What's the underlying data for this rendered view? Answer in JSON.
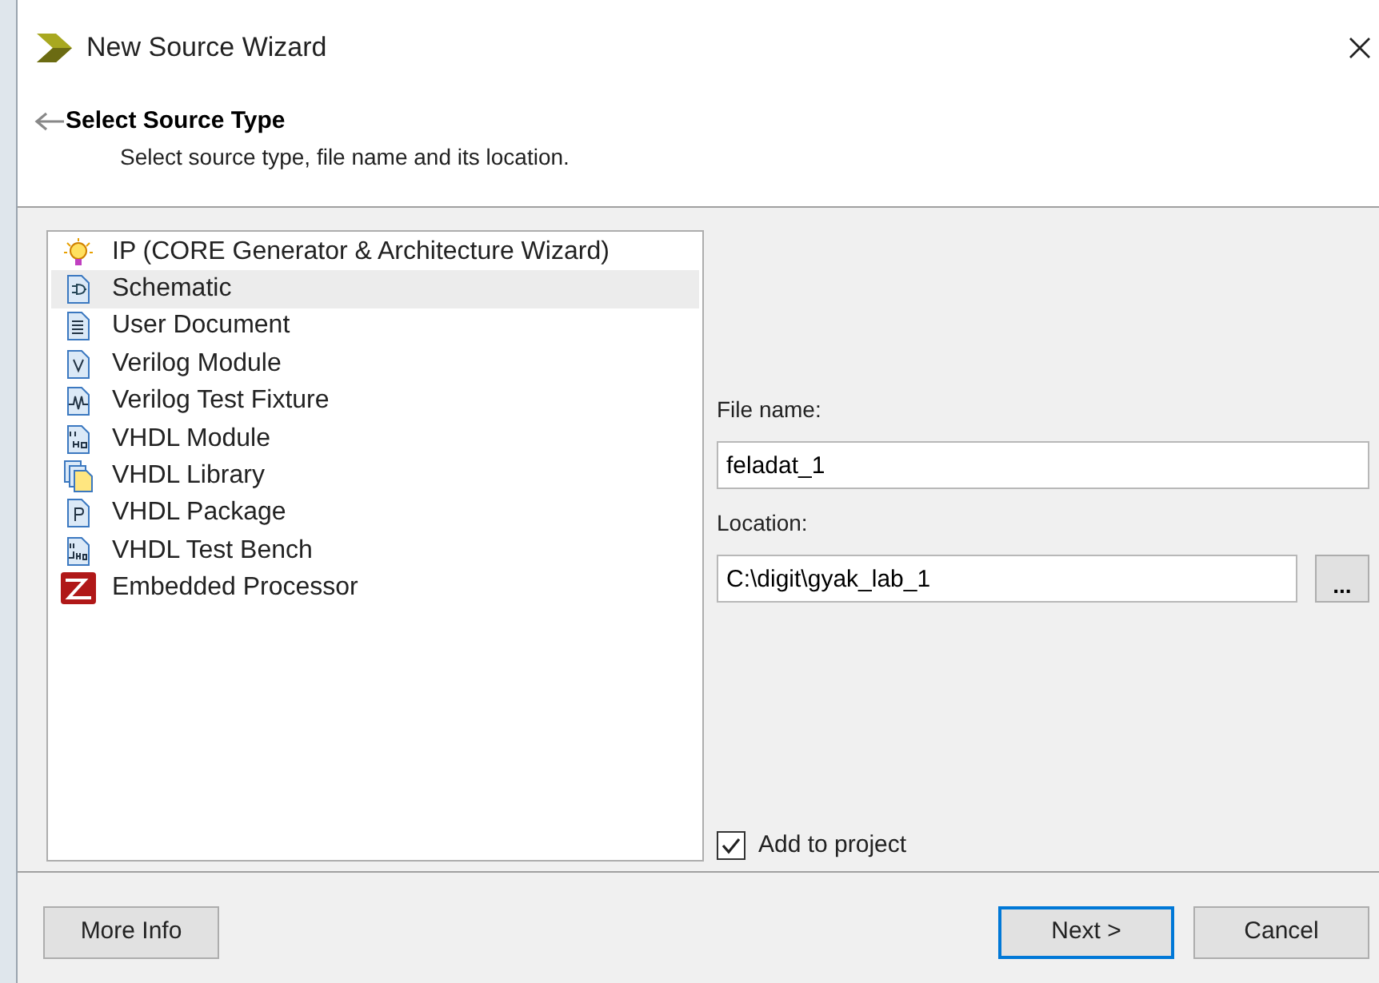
{
  "window": {
    "title": "New Source Wizard"
  },
  "header": {
    "title": "Select Source Type",
    "subtitle": "Select source type, file name and its location."
  },
  "source_types": [
    {
      "label": "IP (CORE Generator & Architecture Wizard)",
      "kind": "bulb",
      "selected": false
    },
    {
      "label": "Schematic",
      "kind": "schematic",
      "selected": true
    },
    {
      "label": "User Document",
      "kind": "text",
      "selected": false
    },
    {
      "label": "Verilog Module",
      "kind": "verilog",
      "selected": false
    },
    {
      "label": "Verilog Test Fixture",
      "kind": "wave",
      "selected": false
    },
    {
      "label": "VHDL Module",
      "kind": "vhdl",
      "selected": false
    },
    {
      "label": "VHDL Library",
      "kind": "library",
      "selected": false
    },
    {
      "label": "VHDL Package",
      "kind": "package",
      "selected": false
    },
    {
      "label": "VHDL Test Bench",
      "kind": "vhdlwave",
      "selected": false
    },
    {
      "label": "Embedded Processor",
      "kind": "processor",
      "selected": false
    }
  ],
  "file_name": {
    "label": "File name:",
    "value": "feladat_1"
  },
  "location": {
    "label": "Location:",
    "value": "C:\\digit\\gyak_lab_1",
    "browse": "..."
  },
  "add_to_project": {
    "label": "Add to project",
    "checked": true
  },
  "buttons": {
    "more_info": "More Info",
    "next": "Next >",
    "cancel": "Cancel"
  }
}
